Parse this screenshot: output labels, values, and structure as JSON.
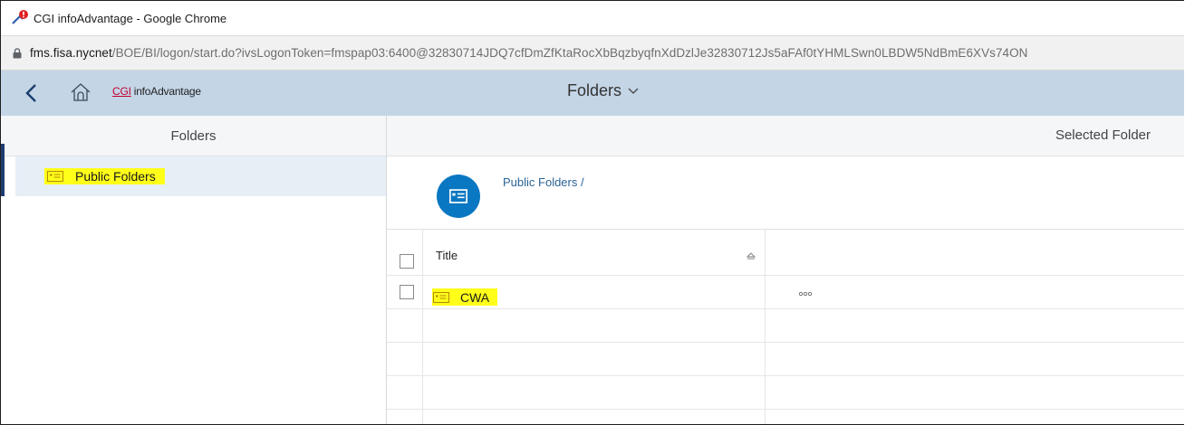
{
  "window": {
    "title": "CGI infoAdvantage - Google Chrome",
    "url_host": "fms.fisa.nycnet",
    "url_path": "/BOE/BI/logon/start.do?ivsLogonToken=fmspap03:6400@32830714JDQ7cfDmZfKtaRocXbBqzbyqfnXdDzlJe32830712Js5aFAf0tYHMLSwn0LBDW5NdBmE6XVs74ON"
  },
  "shell": {
    "logo_cgi": "CGI",
    "logo_product": "infoAdvantage",
    "app_title": "Folders"
  },
  "left_panel": {
    "header": "Folders",
    "items": [
      {
        "label": "Public Folders",
        "icon": "folder-icon",
        "selected": true,
        "highlighted": true
      }
    ]
  },
  "right_panel": {
    "header": "Selected Folder",
    "breadcrumb": "Public Folders /",
    "table": {
      "columns": [
        "Title",
        ""
      ],
      "rows": [
        {
          "title": "CWA",
          "icon": "folder-icon",
          "highlighted": true,
          "actions": "more-icon"
        }
      ]
    }
  },
  "colors": {
    "shell_bar": "#c4d5e6",
    "accent_blue": "#0a77c2",
    "highlight": "#ffff19",
    "link": "#2a6497",
    "brand_red": "#c2002f"
  }
}
